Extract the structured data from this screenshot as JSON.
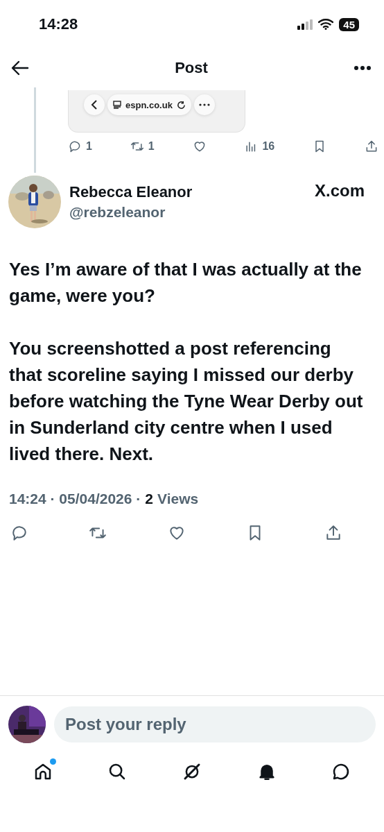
{
  "status_bar": {
    "time": "14:28",
    "battery": "45"
  },
  "header": {
    "title": "Post"
  },
  "quoted_post": {
    "card": {
      "url": "espn.co.uk"
    },
    "actions": [
      {
        "kind": "reply",
        "count": "1"
      },
      {
        "kind": "repost",
        "count": "1"
      },
      {
        "kind": "like"
      },
      {
        "kind": "views",
        "count": "16"
      },
      {
        "kind": "bookmark"
      },
      {
        "kind": "share"
      }
    ]
  },
  "post": {
    "author": {
      "name": "Rebecca Eleanor",
      "handle": "@rebzeleanor"
    },
    "source": "X.com",
    "paragraphs": [
      "Yes I’m aware of that I was actually at the game, were you?",
      "You screenshotted a post referencing that scoreline saying I missed our derby before watching the Tyne Wear Derby out in Sunderland city centre when I used lived there. Next."
    ],
    "timestamp": "14:24 · 05/04/2026 ·",
    "views_count": "2",
    "views_label": "Views",
    "actions": [
      {
        "kind": "reply"
      },
      {
        "kind": "repost"
      },
      {
        "kind": "like"
      },
      {
        "kind": "bookmark"
      },
      {
        "kind": "share"
      }
    ]
  },
  "reply_bar": {
    "placeholder": "Post your reply"
  },
  "tabs": [
    {
      "kind": "home",
      "selected": false,
      "dot": true
    },
    {
      "kind": "search",
      "selected": false,
      "dot": false
    },
    {
      "kind": "grok",
      "selected": false,
      "dot": false
    },
    {
      "kind": "notifications",
      "selected": true,
      "dot": false
    },
    {
      "kind": "messages",
      "selected": false,
      "dot": false
    }
  ]
}
